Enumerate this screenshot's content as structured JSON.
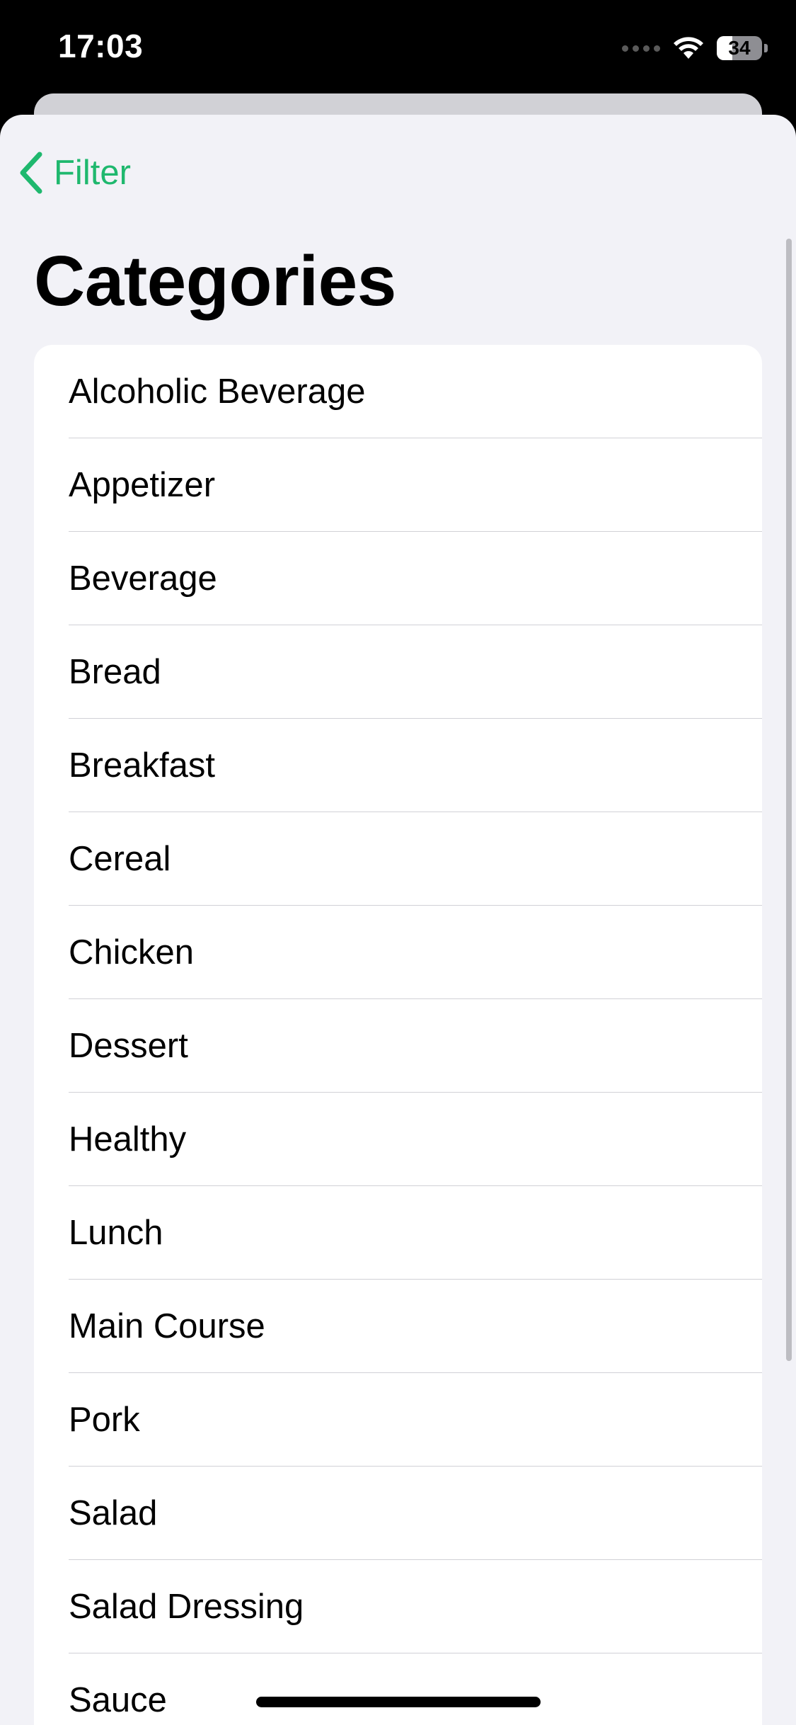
{
  "status_bar": {
    "time": "17:03",
    "battery_level": "34",
    "battery_fraction": 0.34,
    "wifi_icon": "wifi-icon",
    "signal_icon": "cellular-signal-icon"
  },
  "nav": {
    "back_label": "Filter",
    "back_icon": "chevron-left-icon",
    "accent_color": "#1fb86e"
  },
  "page": {
    "title": "Categories"
  },
  "categories": [
    "Alcoholic Beverage",
    "Appetizer",
    "Beverage",
    "Bread",
    "Breakfast",
    "Cereal",
    "Chicken",
    "Dessert",
    "Healthy",
    "Lunch",
    "Main Course",
    "Pork",
    "Salad",
    "Salad Dressing",
    "Sauce"
  ]
}
